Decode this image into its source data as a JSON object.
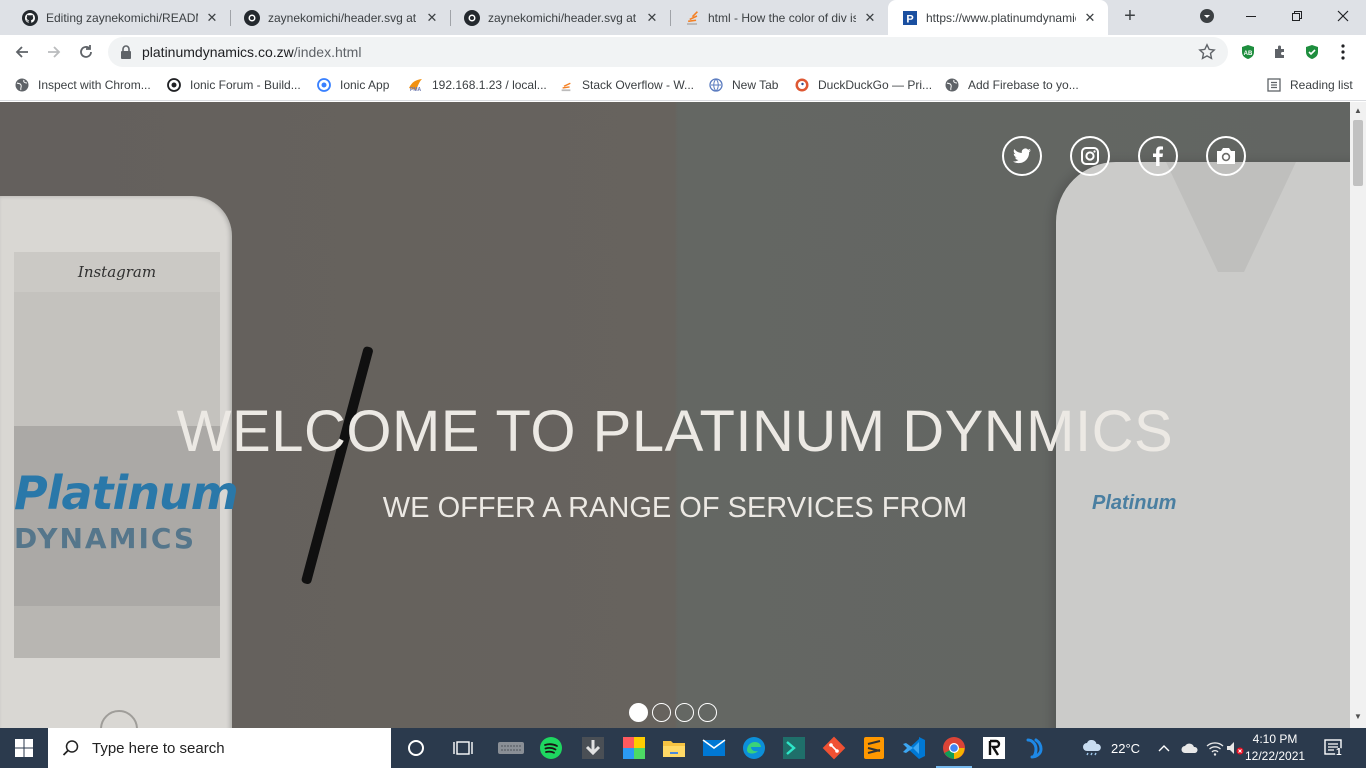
{
  "browser": {
    "tabs": [
      {
        "title": "Editing zaynekomichi/README.md",
        "icon": "github-icon",
        "active": false
      },
      {
        "title": "zaynekomichi/header.svg at main",
        "icon": "github-icon",
        "active": false
      },
      {
        "title": "zaynekomichi/header.svg at main",
        "icon": "github-icon",
        "active": false
      },
      {
        "title": "html - How the color of div is",
        "icon": "stackoverflow-icon",
        "active": false
      },
      {
        "title": "https://www.platinumdynamics",
        "icon": "p-icon",
        "active": true
      }
    ],
    "address": {
      "domain": "platinumdynamics.co.zw",
      "path": "/index.html"
    },
    "bookmarks": [
      {
        "label": "Inspect with Chrom...",
        "icon": "globe-icon"
      },
      {
        "label": "Ionic Forum - Build...",
        "icon": "ionic-icon"
      },
      {
        "label": "Ionic App",
        "icon": "ionic-app-icon"
      },
      {
        "label": "192.168.1.23 / local...",
        "icon": "pma-icon"
      },
      {
        "label": "Stack Overflow - W...",
        "icon": "stackoverflow-icon"
      },
      {
        "label": "New Tab",
        "icon": "newtab-icon"
      },
      {
        "label": "DuckDuckGo — Pri...",
        "icon": "duckduckgo-icon"
      },
      {
        "label": "Add Firebase to yo...",
        "icon": "globe-icon"
      }
    ],
    "reading_list": "Reading list",
    "ext_badge": "AB"
  },
  "page": {
    "headline": "WELCOME TO PLATINUM DYNMICS",
    "subline": "WE OFFER A RANGE OF SERVICES FROM",
    "phone_app": "Instagram",
    "brand_line1": "Platinum",
    "brand_line2": "DYNAMICS",
    "shirt_logo": "Platinum",
    "socials": [
      "twitter-icon",
      "instagram-icon",
      "facebook-icon",
      "camera-icon"
    ],
    "carousel": {
      "count": 4,
      "active": 0
    }
  },
  "taskbar": {
    "search_placeholder": "Type here to search",
    "weather": "22°C",
    "time": "4:10 PM",
    "date": "12/22/2021",
    "notifications": "1"
  }
}
